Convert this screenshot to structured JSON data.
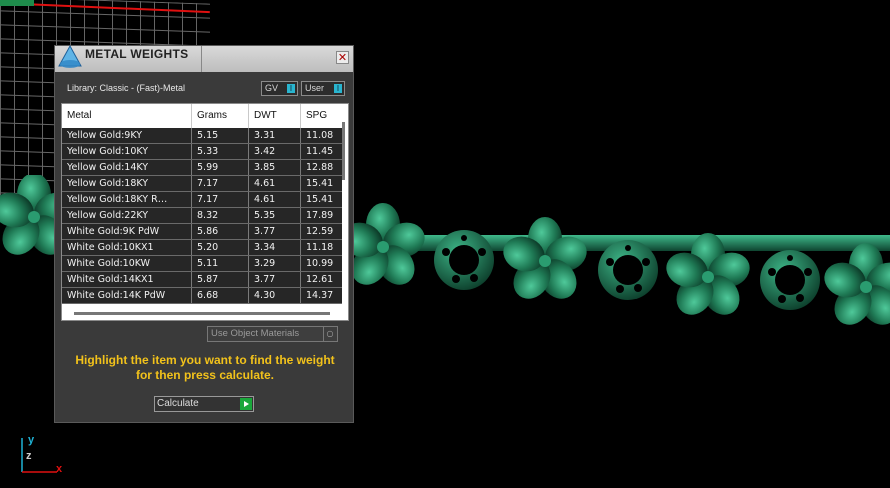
{
  "dialog": {
    "title": "METAL WEIGHTS",
    "close_glyph": "✕",
    "library_label": "Library: Classic - (Fast)-Metal",
    "toggles": [
      {
        "label": "GV"
      },
      {
        "label": "User"
      }
    ],
    "table": {
      "columns": [
        "Metal",
        "Grams",
        "DWT",
        "SPG"
      ],
      "rows": [
        [
          "Yellow Gold:9KY",
          "5.15",
          "3.31",
          "11.08"
        ],
        [
          "Yellow Gold:10KY",
          "5.33",
          "3.42",
          "11.45"
        ],
        [
          "Yellow Gold:14KY",
          "5.99",
          "3.85",
          "12.88"
        ],
        [
          "Yellow Gold:18KY",
          "7.17",
          "4.61",
          "15.41"
        ],
        [
          "Yellow Gold:18KY R…",
          "7.17",
          "4.61",
          "15.41"
        ],
        [
          "Yellow Gold:22KY",
          "8.32",
          "5.35",
          "17.89"
        ],
        [
          "White Gold:9K PdW",
          "5.86",
          "3.77",
          "12.59"
        ],
        [
          "White Gold:10KX1",
          "5.20",
          "3.34",
          "11.18"
        ],
        [
          "White Gold:10KW",
          "5.11",
          "3.29",
          "10.99"
        ],
        [
          "White Gold:14KX1",
          "5.87",
          "3.77",
          "12.61"
        ],
        [
          "White Gold:14K PdW",
          "6.68",
          "4.30",
          "14.37"
        ]
      ]
    },
    "use_object_materials": "Use Object Materials",
    "instructions": "Highlight the item you want to find the weight for then press calculate.",
    "calculate_label": "Calculate"
  },
  "viewport": {
    "axis_labels": {
      "y": "y",
      "z": "z",
      "x": "x"
    },
    "colors": {
      "model": "#1f7a55",
      "grid": "#8a8a8a",
      "axis_x": "#e01010",
      "axis_y": "#1fb3d6"
    }
  }
}
